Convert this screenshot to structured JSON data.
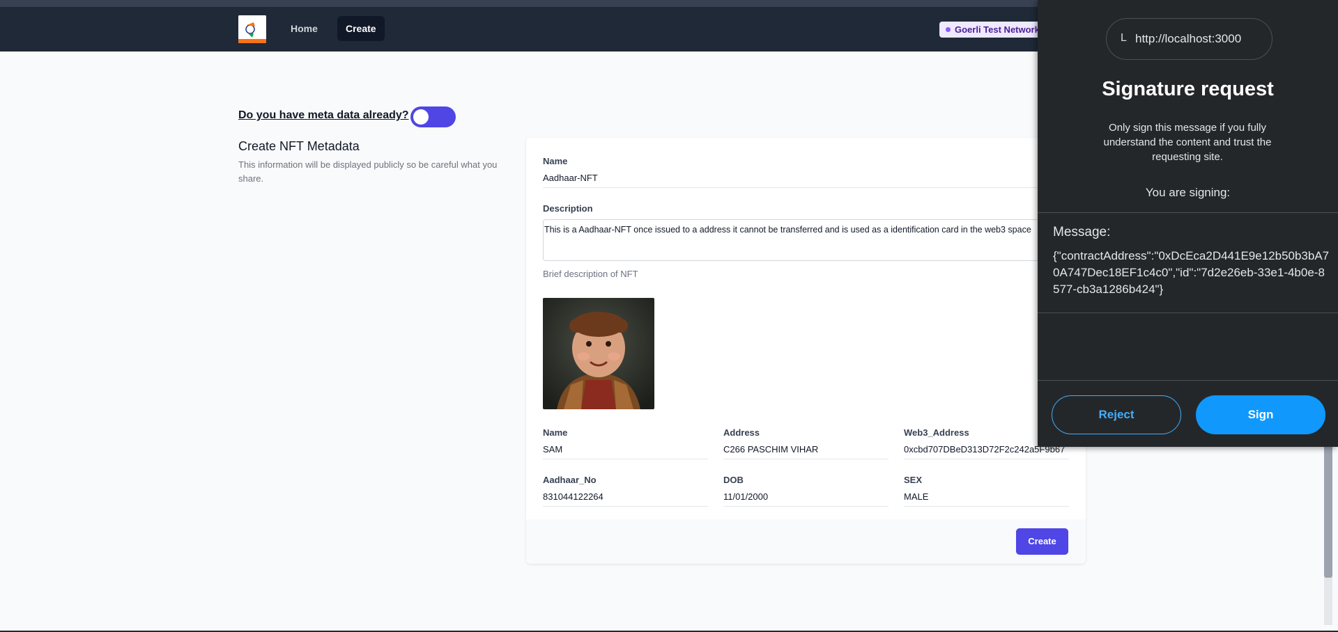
{
  "navbar": {
    "links": [
      {
        "label": "Home"
      },
      {
        "label": "Create"
      }
    ],
    "network": "Goerli Test Network"
  },
  "main": {
    "metadata_question": "Do you have meta data already?",
    "metadata_toggle_on": true,
    "section_title": "Create NFT Metadata",
    "section_desc": "This information will be displayed publicly so be careful what you share."
  },
  "form": {
    "name_label": "Name",
    "name_value": "Aadhaar-NFT",
    "description_label": "Description",
    "description_value": "This is a Aadhaar-NFT once issued to a address it cannot be transferred and is used as a identification card in the web3 space",
    "description_helper": "Brief description of NFT",
    "attributes": [
      {
        "label": "Name",
        "value": "SAM"
      },
      {
        "label": "Address",
        "value": "C266 PASCHIM VIHAR"
      },
      {
        "label": "Web3_Address",
        "value": "0xcbd707DBeD313D72F2c242a5F9b67"
      },
      {
        "label": "Aadhaar_No",
        "value": "831044122264"
      },
      {
        "label": "DOB",
        "value": "11/01/2000"
      },
      {
        "label": "SEX",
        "value": "MALE"
      }
    ],
    "create_label": "Create"
  },
  "signature_popup": {
    "origin": "http://localhost:3000",
    "origin_icon": "L",
    "title": "Signature request",
    "description": "Only sign this message if you fully understand the content and trust the requesting site.",
    "signing_label": "You are signing:",
    "message_label": "Message:",
    "message": "{\"contractAddress\":\"0xDcEca2D441E9e12b50b3bA70A747Dec18EF1c4c0\",\"id\":\"7d2e26eb-33e1-4b0e-8577-cb3a1286b424\"}",
    "reject_label": "Reject",
    "sign_label": "Sign"
  },
  "colors": {
    "accent": "#4f46e5",
    "navbar": "#1f2937",
    "popup_bg": "#24272a",
    "metamask_blue": "#1098fc"
  }
}
